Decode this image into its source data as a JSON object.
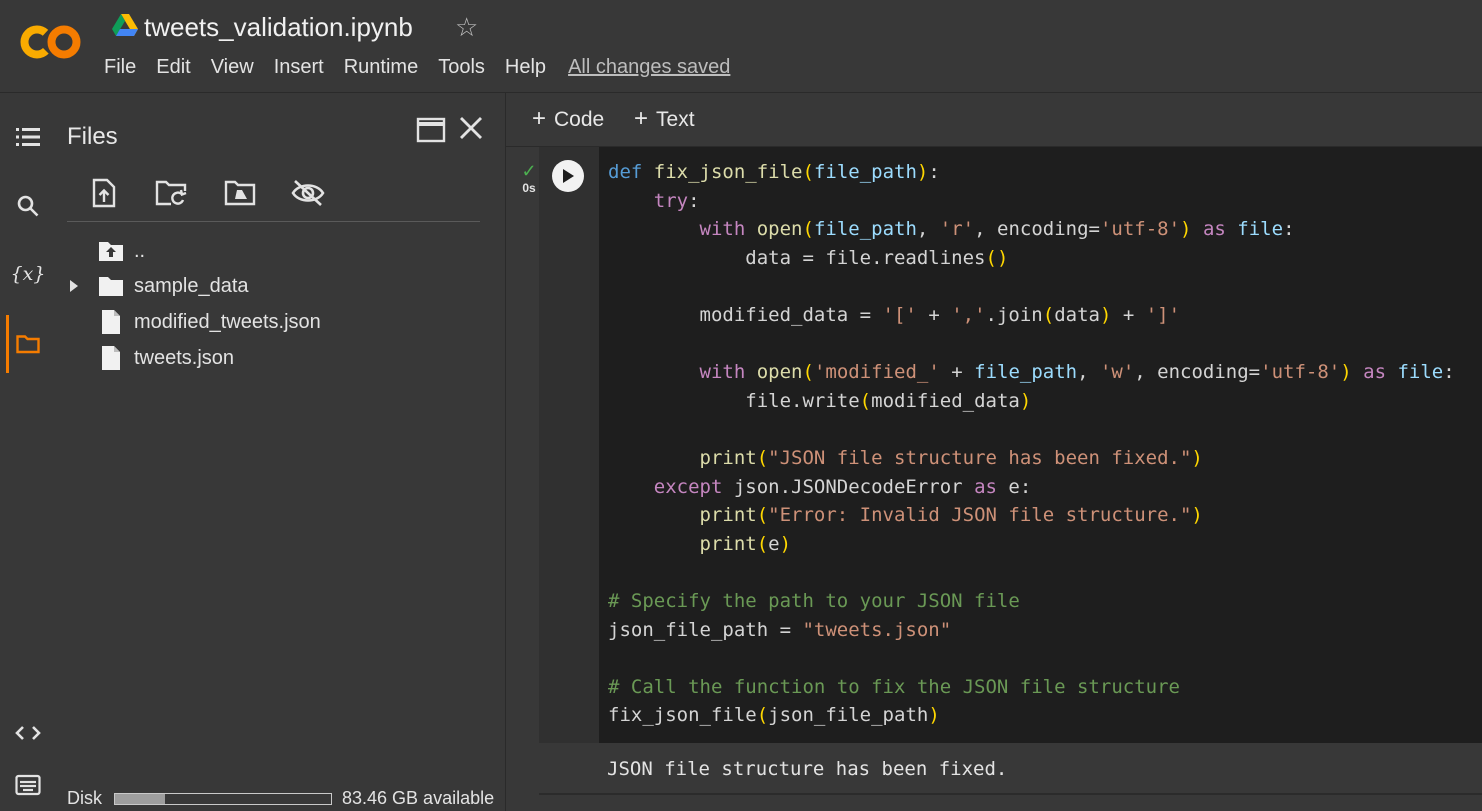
{
  "header": {
    "title": "tweets_validation.ipynb",
    "save_status": "All changes saved",
    "menu": [
      "File",
      "Edit",
      "View",
      "Insert",
      "Runtime",
      "Tools",
      "Help"
    ]
  },
  "rail": {
    "icons": [
      "toc-icon",
      "search-icon",
      "variables-icon",
      "folder-icon",
      "code-snippets-icon",
      "terminal-icon"
    ],
    "active": "folder-icon",
    "variables_glyph": "{x}"
  },
  "files": {
    "title": "Files",
    "toolbar": [
      "upload-file-icon",
      "refresh-icon",
      "mount-drive-icon",
      "hide-icon"
    ],
    "tree": [
      {
        "label": "..",
        "type": "parent"
      },
      {
        "label": "sample_data",
        "type": "folder",
        "expandable": true
      },
      {
        "label": "modified_tweets.json",
        "type": "file"
      },
      {
        "label": "tweets.json",
        "type": "file"
      }
    ],
    "disk": {
      "label": "Disk",
      "used_fraction": 0.23,
      "available": "83.46 GB available"
    }
  },
  "notebook": {
    "add_code": "Code",
    "add_text": "Text",
    "cell": {
      "exec_time": "0s",
      "code_lines": [
        "def fix_json_file(file_path):",
        "    try:",
        "        with open(file_path, 'r', encoding='utf-8') as file:",
        "            data = file.readlines()",
        "",
        "        modified_data = '[' + ','.join(data) + ']'",
        "",
        "        with open('modified_' + file_path, 'w', encoding='utf-8') as file:",
        "            file.write(modified_data)",
        "",
        "        print(\"JSON file structure has been fixed.\")",
        "    except json.JSONDecodeError as e:",
        "        print(\"Error: Invalid JSON file structure.\")",
        "        print(e)",
        "",
        "# Specify the path to your JSON file",
        "json_file_path = \"tweets.json\"",
        "",
        "# Call the function to fix the JSON file structure",
        "fix_json_file(json_file_path)"
      ],
      "output": "JSON file structure has been fixed."
    }
  },
  "colors": {
    "accent": "#f57c00",
    "background": "#383838",
    "editor_bg": "#1e1e1e",
    "check": "#4caf50"
  }
}
